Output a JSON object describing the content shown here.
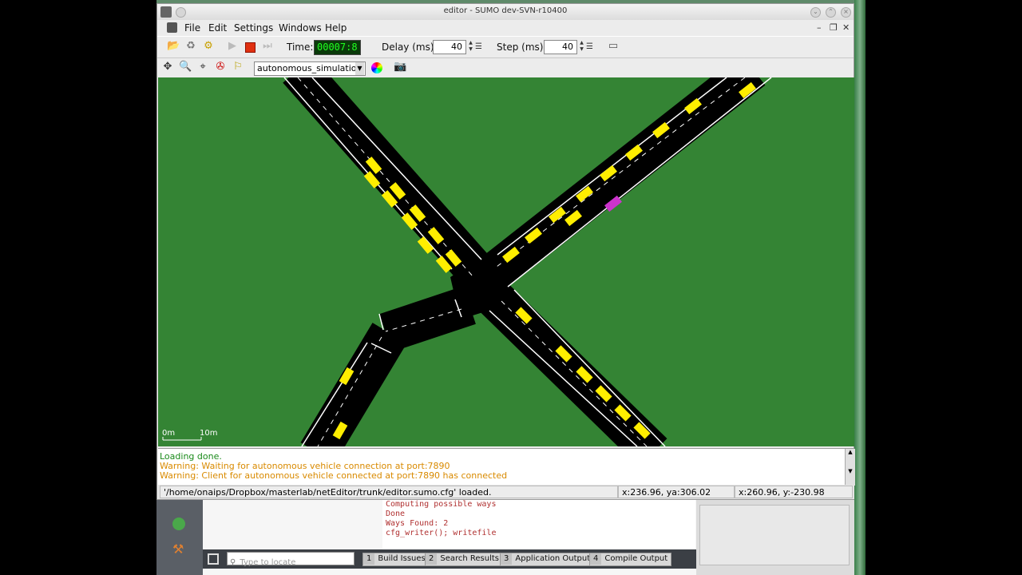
{
  "window": {
    "title": "editor - SUMO dev-SVN-r10400"
  },
  "menu": {
    "items": [
      "File",
      "Edit",
      "Settings",
      "Windows",
      "Help"
    ]
  },
  "toolbar": {
    "time_label": "Time:",
    "time_value": "00007:8",
    "delay_label": "Delay (ms):",
    "delay_value": "40",
    "step_label": "Step (ms):",
    "step_value": "40"
  },
  "view": {
    "scheme": "autonomous_simulation",
    "scale_start": "0m",
    "scale_end": "10m"
  },
  "messages": [
    {
      "text": "Loading done.",
      "color": "#1a8a1a"
    },
    {
      "text": "Warning: Waiting for autonomous vehicle connection at port:7890",
      "color": "#d98a00"
    },
    {
      "text": "Warning: Client for autonomous vehicle connected at port:7890 has connected",
      "color": "#d98a00"
    }
  ],
  "status": {
    "file": "'/home/onaips/Dropbox/masterlab/netEditor/trunk/editor.sumo.cfg' loaded.",
    "coord1": "x:236.96, ya:306.02",
    "coord2": "x:260.96, y:-230.98"
  },
  "ide": {
    "output": [
      "Computing possible ways",
      "Done",
      "Ways Found:  2",
      "cfg_writer(); writefile"
    ],
    "search_placeholder": "Type to locate",
    "tabs": [
      {
        "num": "1",
        "label": "Build Issues"
      },
      {
        "num": "2",
        "label": "Search Results"
      },
      {
        "num": "3",
        "label": "Application Output"
      },
      {
        "num": "4",
        "label": "Compile Output"
      }
    ]
  },
  "colors": {
    "grass": "#348434",
    "road": "#000000",
    "vehicle": "#ffee00",
    "ego_vehicle": "#cc33cc"
  },
  "icons": [
    "open-icon",
    "reload-icon",
    "save-icon",
    "play-icon",
    "stop-icon",
    "step-icon",
    "zoom-icon",
    "locate-icon",
    "colorwheel-icon",
    "camera-icon"
  ]
}
